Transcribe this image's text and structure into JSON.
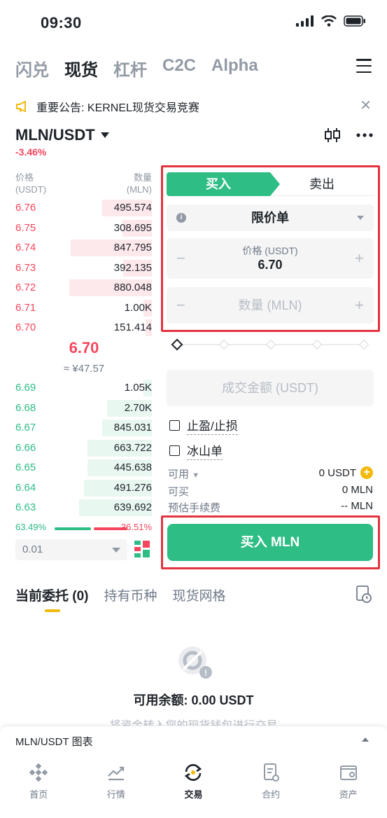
{
  "status": {
    "time": "09:30"
  },
  "top_tabs": [
    "闪兑",
    "现货",
    "杠杆",
    "C2C",
    "Alpha"
  ],
  "announcement": "重要公告: KERNEL现货交易竞赛",
  "pair": {
    "symbol": "MLN/USDT",
    "change": "-3.46%"
  },
  "order_book": {
    "price_header": "价格",
    "price_unit": "(USDT)",
    "qty_header": "数量",
    "qty_unit": "(MLN)",
    "asks": [
      {
        "price": "6.76",
        "qty": "495.574",
        "depth": 0.6
      },
      {
        "price": "6.75",
        "qty": "308.695",
        "depth": 0.36
      },
      {
        "price": "6.74",
        "qty": "847.795",
        "depth": 0.98
      },
      {
        "price": "6.73",
        "qty": "392.135",
        "depth": 0.35
      },
      {
        "price": "6.72",
        "qty": "880.048",
        "depth": 1.0
      },
      {
        "price": "6.71",
        "qty": "1.00K",
        "depth": 0.1
      },
      {
        "price": "6.70",
        "qty": "151.414",
        "depth": 0.08
      }
    ],
    "mid_price": "6.70",
    "mid_fiat": "≈ ¥47.57",
    "bids": [
      {
        "price": "6.69",
        "qty": "1.05K",
        "depth": 0.1
      },
      {
        "price": "6.68",
        "qty": "2.70K",
        "depth": 0.54
      },
      {
        "price": "6.67",
        "qty": "845.031",
        "depth": 0.6
      },
      {
        "price": "6.66",
        "qty": "663.722",
        "depth": 0.78
      },
      {
        "price": "6.65",
        "qty": "445.638",
        "depth": 0.78
      },
      {
        "price": "6.64",
        "qty": "491.276",
        "depth": 0.82
      },
      {
        "price": "6.63",
        "qty": "639.692",
        "depth": 0.88
      }
    ],
    "buy_ratio": "63.49%",
    "sell_ratio": "36.51%",
    "precision": "0.01"
  },
  "order_form": {
    "buy_tab": "买入",
    "sell_tab": "卖出",
    "order_type": "限价单",
    "price_label": "价格 (USDT)",
    "price_value": "6.70",
    "qty_placeholder": "数量 (MLN)",
    "amount_placeholder": "成交金额 (USDT)",
    "tp_sl": "止盈/止损",
    "iceberg": "冰山单",
    "available_label": "可用",
    "available_value": "0 USDT",
    "can_buy_label": "可买",
    "can_buy_value": "0 MLN",
    "fee_label": "预估手续费",
    "fee_value": "-- MLN",
    "buy_button": "买入 MLN"
  },
  "orders": {
    "tabs": [
      "当前委托 (0)",
      "持有币种",
      "现货网格"
    ],
    "balance": "可用余额:  0.00 USDT",
    "hint": "将资金转入您的现货钱包进行交易"
  },
  "chart_bar": "MLN/USDT 图表",
  "nav": [
    "首页",
    "行情",
    "交易",
    "合约",
    "资产"
  ],
  "colors": {
    "buy": "#2ebd85",
    "sell": "#f6465d",
    "accent": "#f0b90b",
    "highlight": "#e2333f"
  }
}
